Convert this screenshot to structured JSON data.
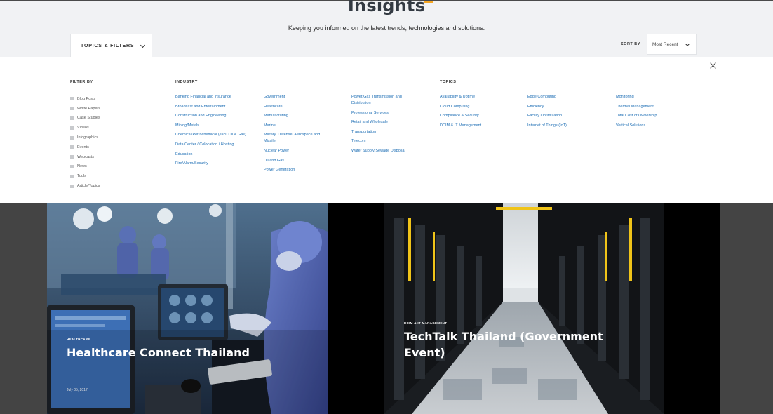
{
  "header": {
    "title": "Insights",
    "subtitle": "Keeping you informed on the latest trends, technologies and solutions.",
    "filters_toggle": "TOPICS & FILTERS",
    "sort_label": "SORT BY",
    "sort_value": "Most Recent"
  },
  "filters": {
    "filter_by": {
      "heading": "FILTER BY",
      "items": [
        "Blog Posts",
        "White Papers",
        "Case Studies",
        "Videos",
        "Infographics",
        "Events",
        "Webcasts",
        "News",
        "Tools",
        "Article/Topics"
      ]
    },
    "industry": {
      "heading": "INDUSTRY",
      "col1": [
        "Banking Financial and Insurance",
        "Broadcast and Entertainment",
        "Construction and Engineering",
        "Mining/Metals",
        "Chemical/Petrochemical (excl. Oil & Gas)",
        "Data Center / Colocation / Hosting",
        "Education",
        "Fire/Alarm/Security"
      ],
      "col2": [
        "Government",
        "Healthcare",
        "Manufacturing",
        "Marine",
        "Military, Defense, Aerospace and Missile",
        "Nuclear Power",
        "Oil and Gas",
        "Power Generation"
      ],
      "col3": [
        "Power/Gas Transmission and Distribution",
        "Professional Services",
        "Retail and Wholesale",
        "Transportation",
        "Telecom",
        "Water Supply/Sewage Disposal"
      ]
    },
    "topics": {
      "heading": "TOPICS",
      "col1": [
        "Availability & Uptime",
        "Cloud Computing",
        "Compliance & Security",
        "DCIM & IT Management"
      ],
      "col2": [
        "Edge Computing",
        "Efficiency",
        "Facility Optimization",
        "Internet of Things (IoT)"
      ],
      "col3": [
        "Monitoring",
        "Thermal Management",
        "Total Cost of Ownership",
        "Vertical Solutions"
      ]
    }
  },
  "cards": [
    {
      "category": "HEALTHCARE",
      "title": "Healthcare Connect Thailand",
      "date": "July 05, 2017"
    },
    {
      "category": "DCIM & IT MANAGEMENT",
      "title": "TechTalk Thailand (Government Event)"
    }
  ],
  "colors": {
    "link": "#1f6fb5",
    "accent": "#f5a623",
    "header_bg": "#f1f2f4"
  }
}
